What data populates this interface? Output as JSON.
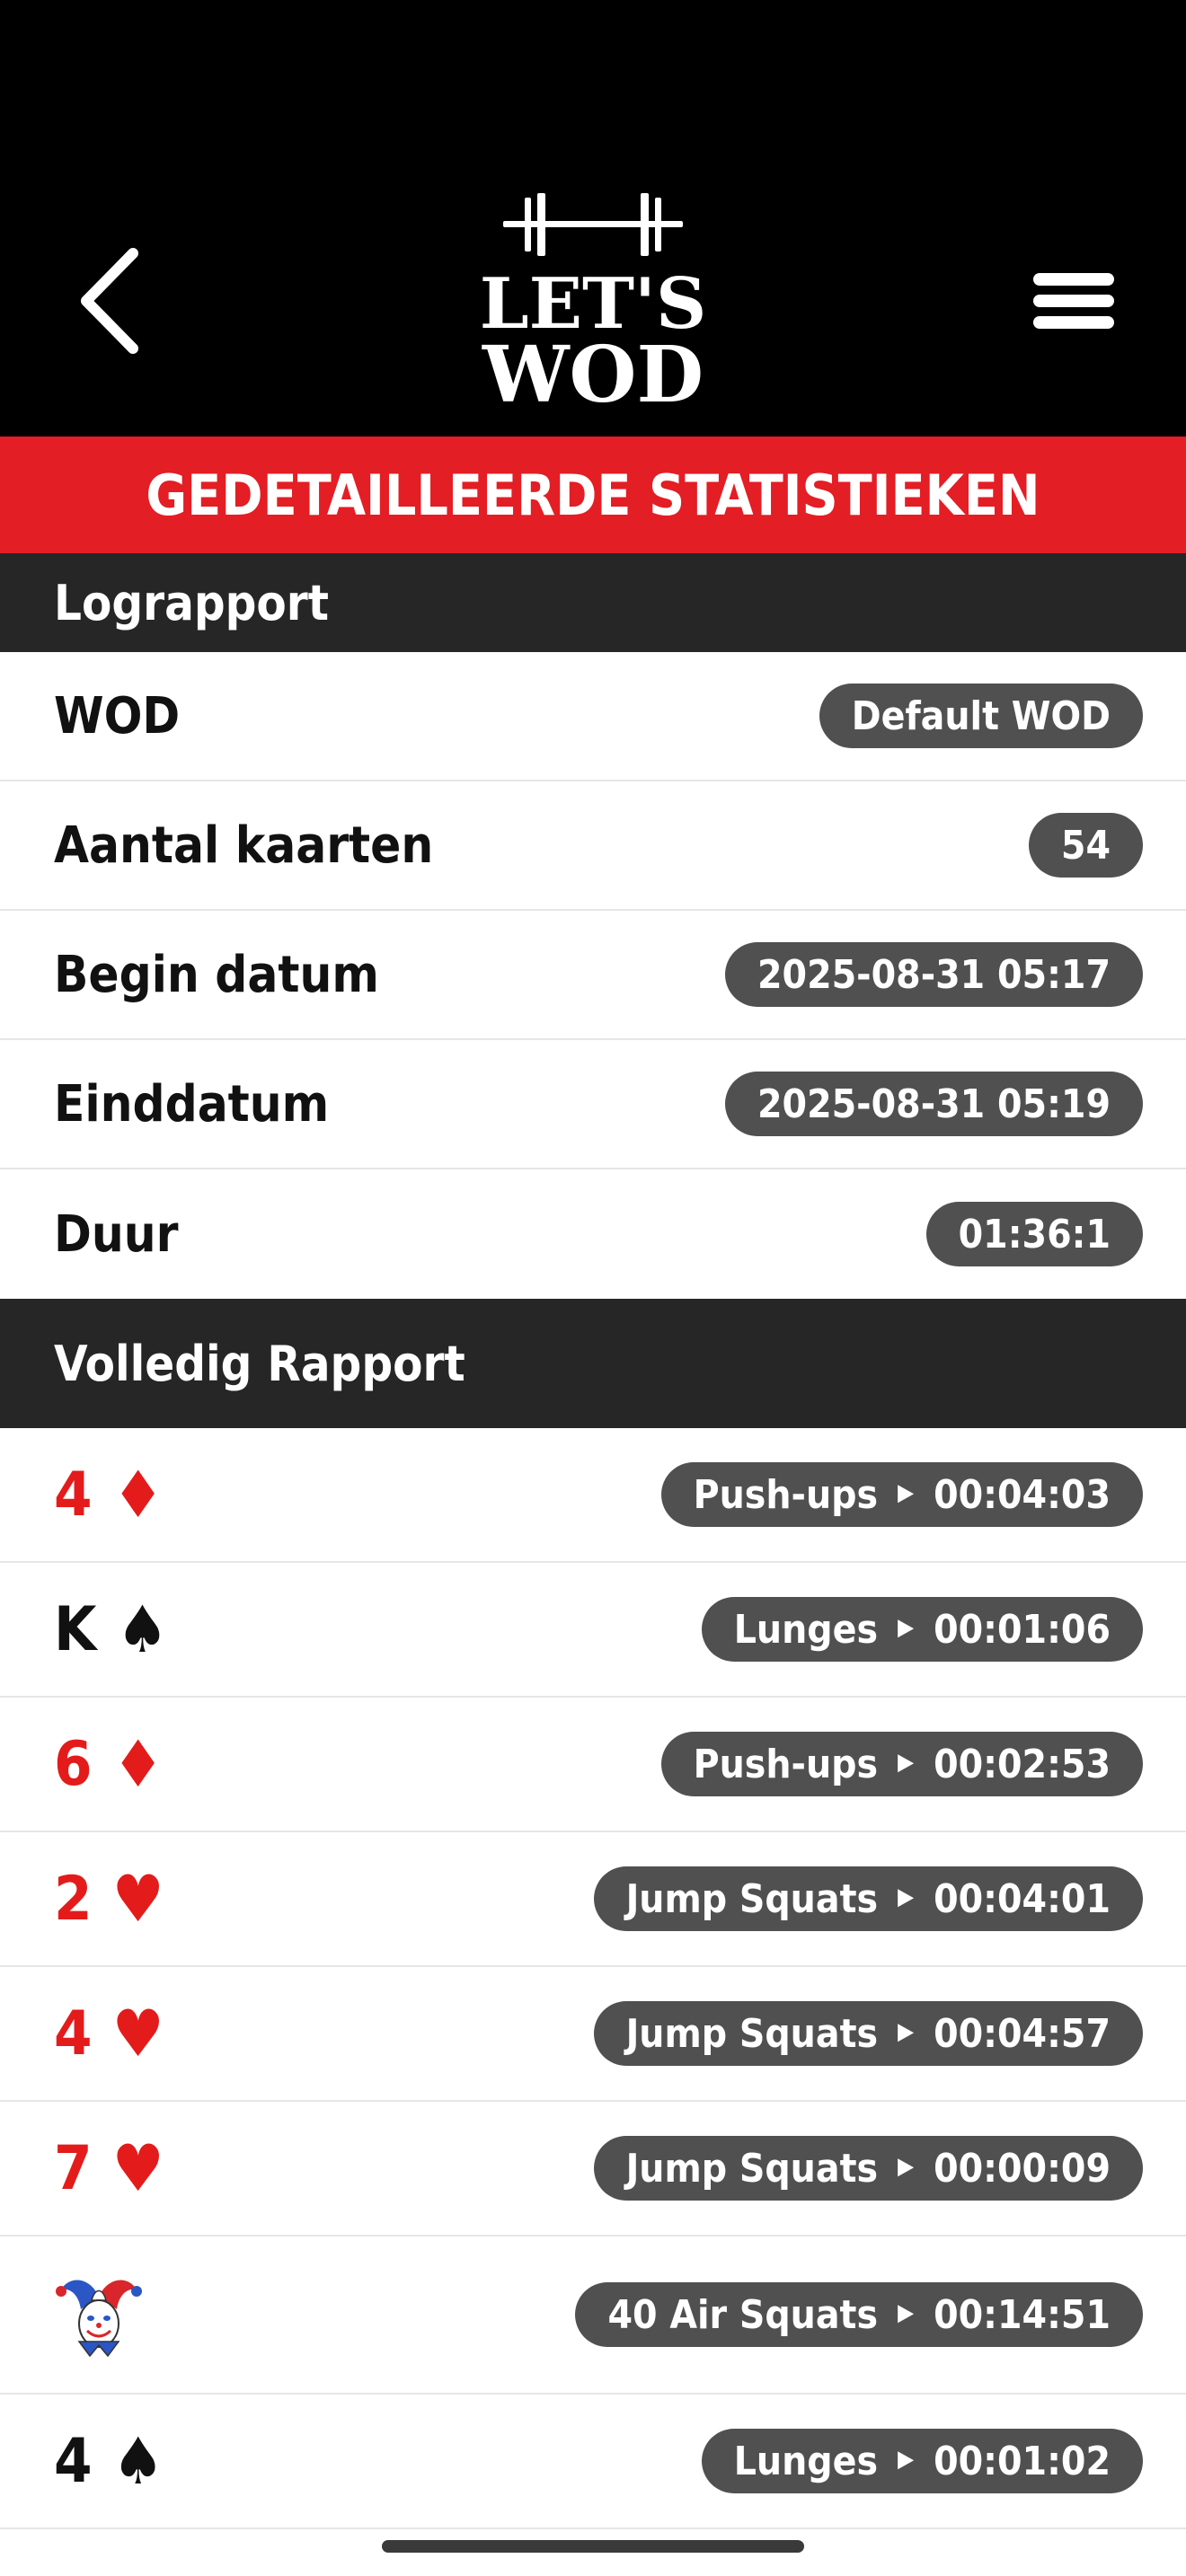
{
  "header": {
    "logo_line1": "LET'S",
    "logo_line2": "WOD"
  },
  "title_bar": {
    "title": "GEDETAILLEERDE STATISTIEKEN",
    "color": "#e31e24"
  },
  "log_report": {
    "heading": "Lograpport",
    "rows": [
      {
        "label": "WOD",
        "value": "Default WOD"
      },
      {
        "label": "Aantal kaarten",
        "value": "54"
      },
      {
        "label": "Begin datum",
        "value": "2025-08-31 05:17"
      },
      {
        "label": "Einddatum",
        "value": "2025-08-31 05:19"
      },
      {
        "label": "Duur",
        "value": "01:36:1"
      }
    ]
  },
  "full_report": {
    "heading": "Volledig Rapport",
    "entries": [
      {
        "rank": "4",
        "suit": "♦",
        "color": "red",
        "exercise": "Push-ups",
        "time": "00:04:03"
      },
      {
        "rank": "K",
        "suit": "♠",
        "color": "black",
        "exercise": "Lunges",
        "time": "00:01:06"
      },
      {
        "rank": "6",
        "suit": "♦",
        "color": "red",
        "exercise": "Push-ups",
        "time": "00:02:53"
      },
      {
        "rank": "2",
        "suit": "♥",
        "color": "red",
        "exercise": "Jump Squats",
        "time": "00:04:01"
      },
      {
        "rank": "4",
        "suit": "♥",
        "color": "red",
        "exercise": "Jump Squats",
        "time": "00:04:57"
      },
      {
        "rank": "7",
        "suit": "♥",
        "color": "red",
        "exercise": "Jump Squats",
        "time": "00:00:09"
      },
      {
        "rank": "",
        "suit": "joker",
        "color": "multi",
        "exercise": "40 Air Squats",
        "time": "00:14:51"
      },
      {
        "rank": "4",
        "suit": "♠",
        "color": "black",
        "exercise": "Lunges",
        "time": "00:01:02"
      }
    ],
    "arrow": "▶"
  },
  "icons": {
    "back": "chevron-left-icon",
    "menu": "hamburger-menu-icon",
    "joker": "joker-icon"
  }
}
